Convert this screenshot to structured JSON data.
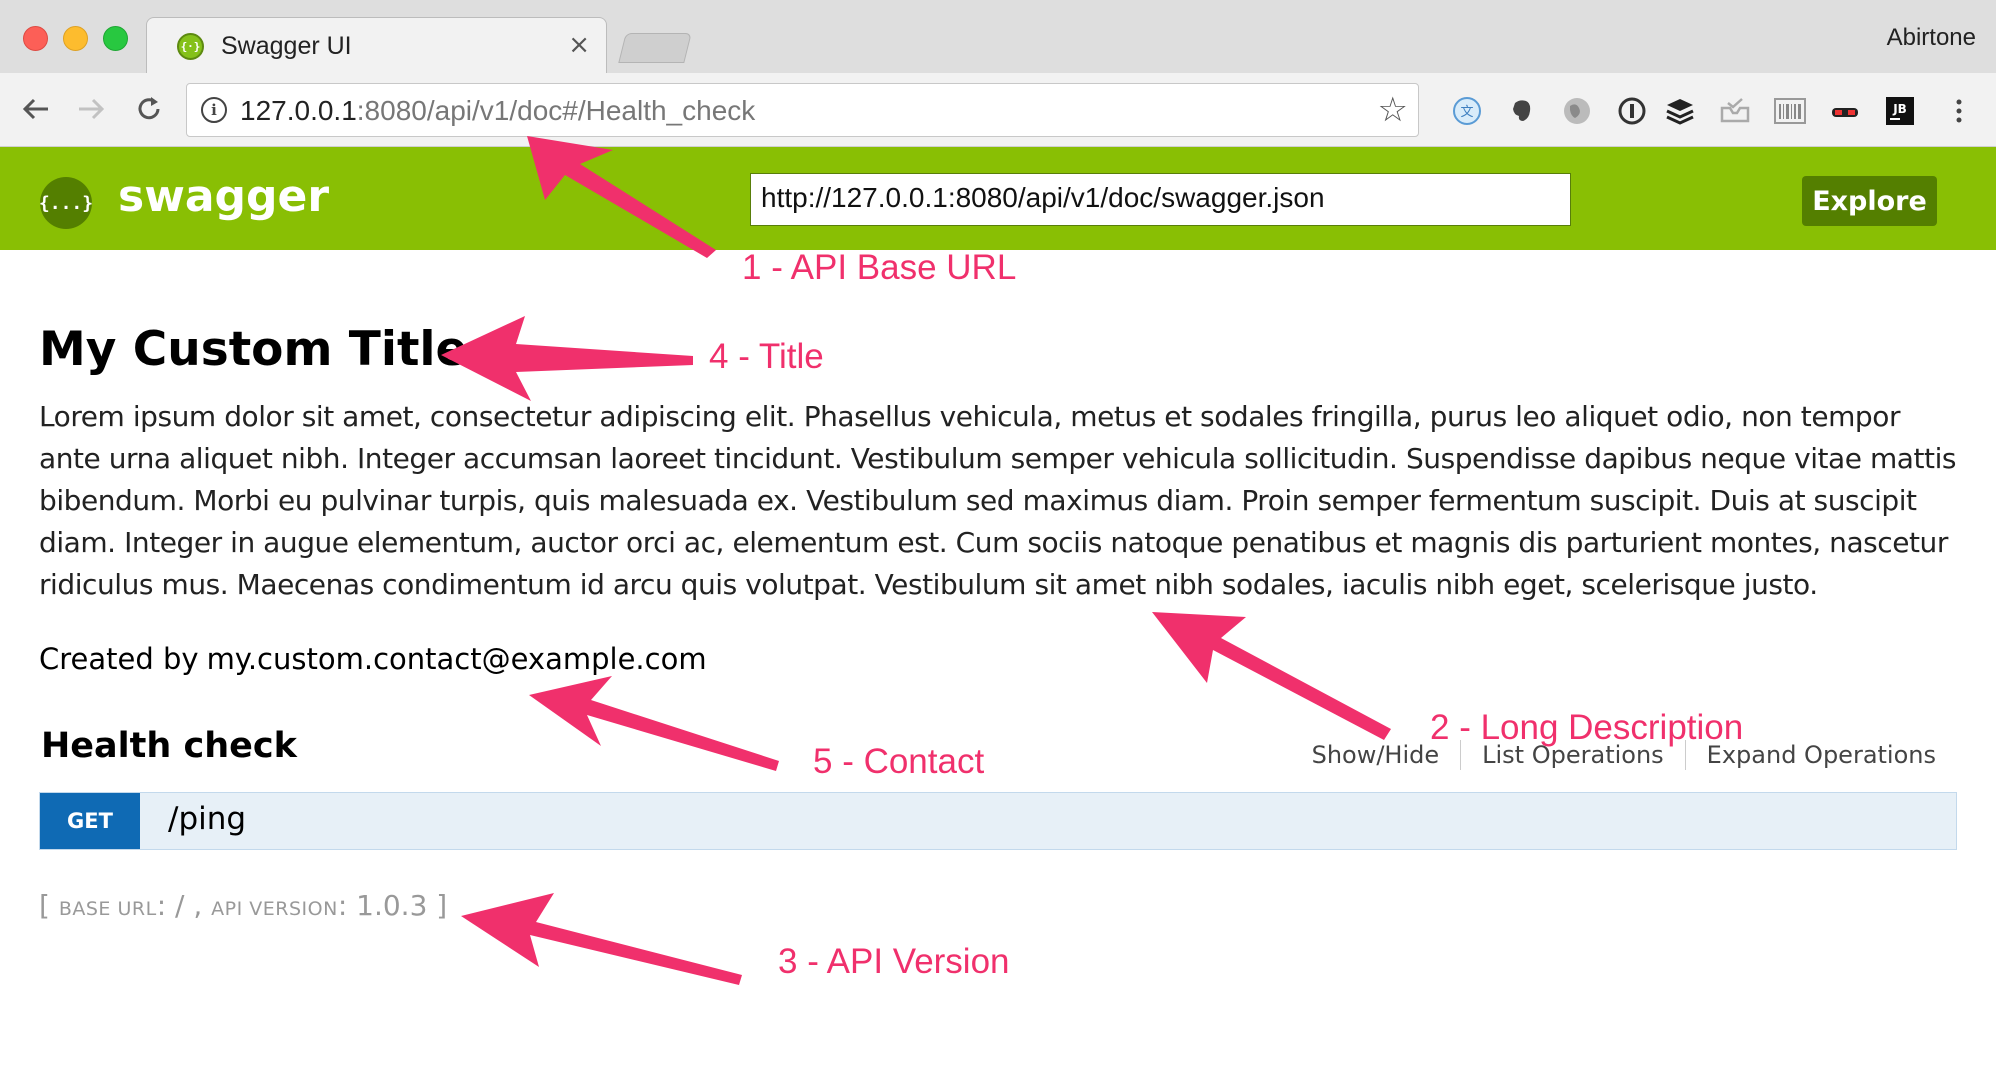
{
  "browser": {
    "tab_title": "Swagger UI",
    "tab_close": "×",
    "profile_name": "Abirtone",
    "url_host": "127.0.0.1",
    "url_rest": ":8080/api/v1/doc#/Health_check",
    "extensions": [
      "translate-icon",
      "evernote-icon",
      "globe-icon",
      "onepassword-icon",
      "buffer-icon",
      "inbox-icon",
      "barcode-icon",
      "disguise-icon",
      "jetbrains-icon",
      "more-icon"
    ],
    "jetbrains_label": "JB"
  },
  "header": {
    "brand": "swagger",
    "logo_glyph": "{...}",
    "spec_url": "http://127.0.0.1:8080/api/v1/doc/swagger.json",
    "explore_label": "Explore",
    "accent_color": "#89bf04"
  },
  "info": {
    "title": "My Custom Title",
    "description": "Lorem ipsum dolor sit amet, consectetur adipiscing elit. Phasellus vehicula, metus et sodales fringilla, purus leo aliquet odio, non tempor ante urna aliquet nibh. Integer accumsan laoreet tincidunt. Vestibulum semper vehicula sollicitudin. Suspendisse dapibus neque vitae mattis bibendum. Morbi eu pulvinar turpis, quis malesuada ex. Vestibulum sed maximus diam. Proin semper fermentum suscipit. Duis at suscipit diam. Integer in augue elementum, auctor orci ac, elementum est. Cum sociis natoque penatibus et magnis dis parturient montes, nascetur ridiculus mus. Maecenas condimentum id arcu quis volutpat. Vestibulum sit amet nibh sodales, iaculis nibh eget, scelerisque justo.",
    "contact_prefix": "Created by",
    "contact_email": "my.custom.contact@example.com"
  },
  "resource": {
    "name": "Health check",
    "options": [
      "Show/Hide",
      "List Operations",
      "Expand Operations"
    ],
    "operations": [
      {
        "method": "GET",
        "path": "/ping",
        "method_color": "#0f6ab4"
      }
    ]
  },
  "footer": {
    "open": "[",
    "base_url_label": "Base url",
    "base_url_value": ": / ,",
    "api_version_label": "api version",
    "api_version_value": ": 1.0.3",
    "close": "]"
  },
  "annotations": {
    "color": "#f0306c",
    "labels": [
      "1 - API Base URL",
      "4 - Title",
      "2 - Long Description",
      "5 - Contact",
      "3 - API Version"
    ]
  }
}
